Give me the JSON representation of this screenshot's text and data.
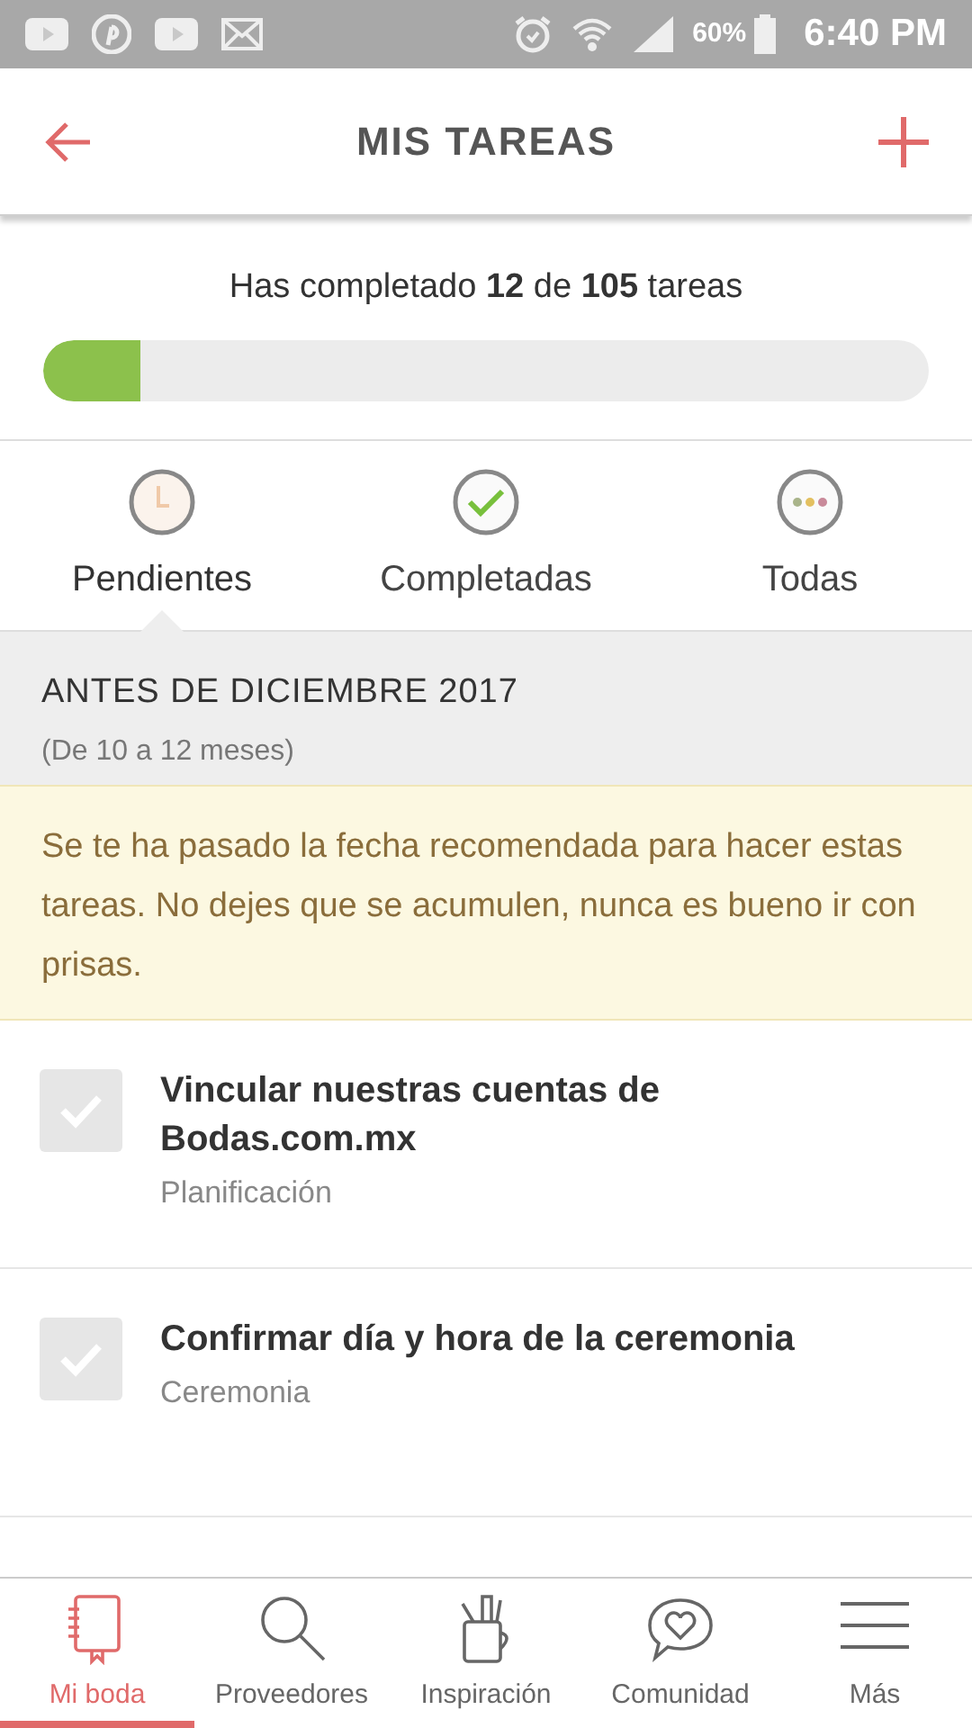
{
  "status_bar": {
    "battery": "60%",
    "time": "6:40 PM"
  },
  "header": {
    "title": "MIS TAREAS"
  },
  "progress": {
    "text": "Has completado **12** de **105** tareas",
    "level": 0.11
  },
  "tabs": [
    {
      "label": "Pendientes",
      "kind": "pending",
      "selected": true
    },
    {
      "label": "Completadas",
      "kind": "done",
      "selected": false
    },
    {
      "label": "Todas",
      "kind": "all",
      "selected": false
    }
  ],
  "section": {
    "title": "ANTES DE DICIEMBRE 2017",
    "subtitle": "(De 10 a 12 meses)"
  },
  "notice": "Se te ha pasado la fecha recomendada para hacer estas tareas. No dejes que se acumulen, nunca es bueno ir con prisas.",
  "tasks": [
    {
      "title": "Vincular nuestras cuentas de Bodas.com.mx",
      "category": "Planificación",
      "checked": false
    },
    {
      "title": "Confirmar día y hora de la ceremonia",
      "category": "Ceremonia",
      "checked": false
    }
  ],
  "bottom_nav": [
    {
      "label": "Mi boda",
      "kind": "notebook",
      "selected": true
    },
    {
      "label": "Proveedores",
      "kind": "search",
      "selected": false
    },
    {
      "label": "Inspiración",
      "kind": "cup",
      "selected": false
    },
    {
      "label": "Comunidad",
      "kind": "chat",
      "selected": false
    },
    {
      "label": "Más",
      "kind": "menu",
      "selected": false
    }
  ]
}
